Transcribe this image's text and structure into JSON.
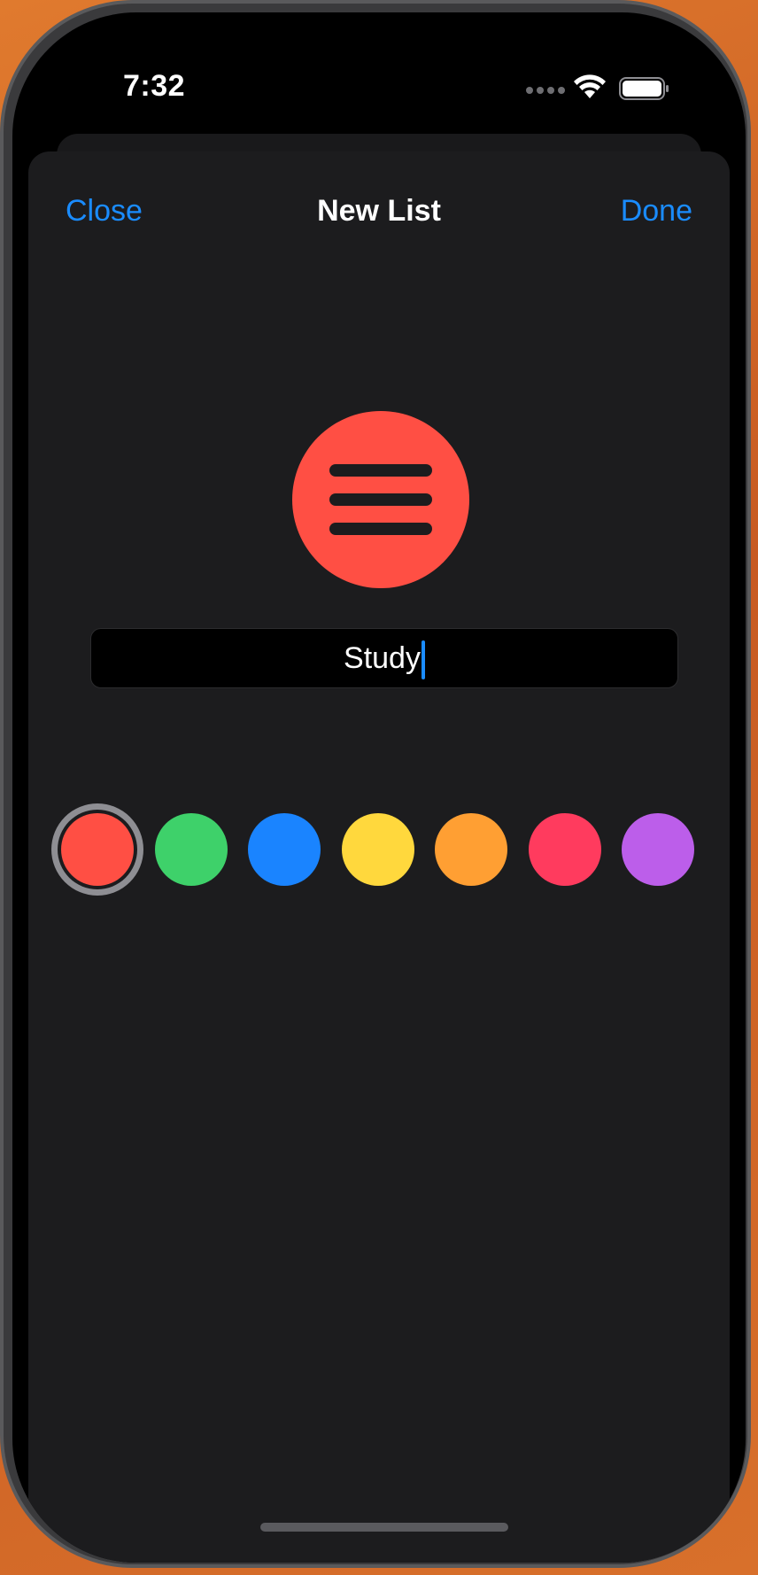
{
  "status_bar": {
    "time": "7:32"
  },
  "header": {
    "close_label": "Close",
    "title": "New List",
    "done_label": "Done"
  },
  "list_icon": {
    "icon": "list-bullet-icon",
    "color": "#ff4f44"
  },
  "name_field": {
    "value": "Study"
  },
  "colors": {
    "selected_index": 0,
    "options": [
      "#ff4f44",
      "#3ed16a",
      "#1a84ff",
      "#ffd83d",
      "#ff9f33",
      "#ff3b5e",
      "#bc5eea"
    ]
  },
  "theme": {
    "accent": "#1a8cff",
    "sheet_background": "#1c1c1e"
  }
}
